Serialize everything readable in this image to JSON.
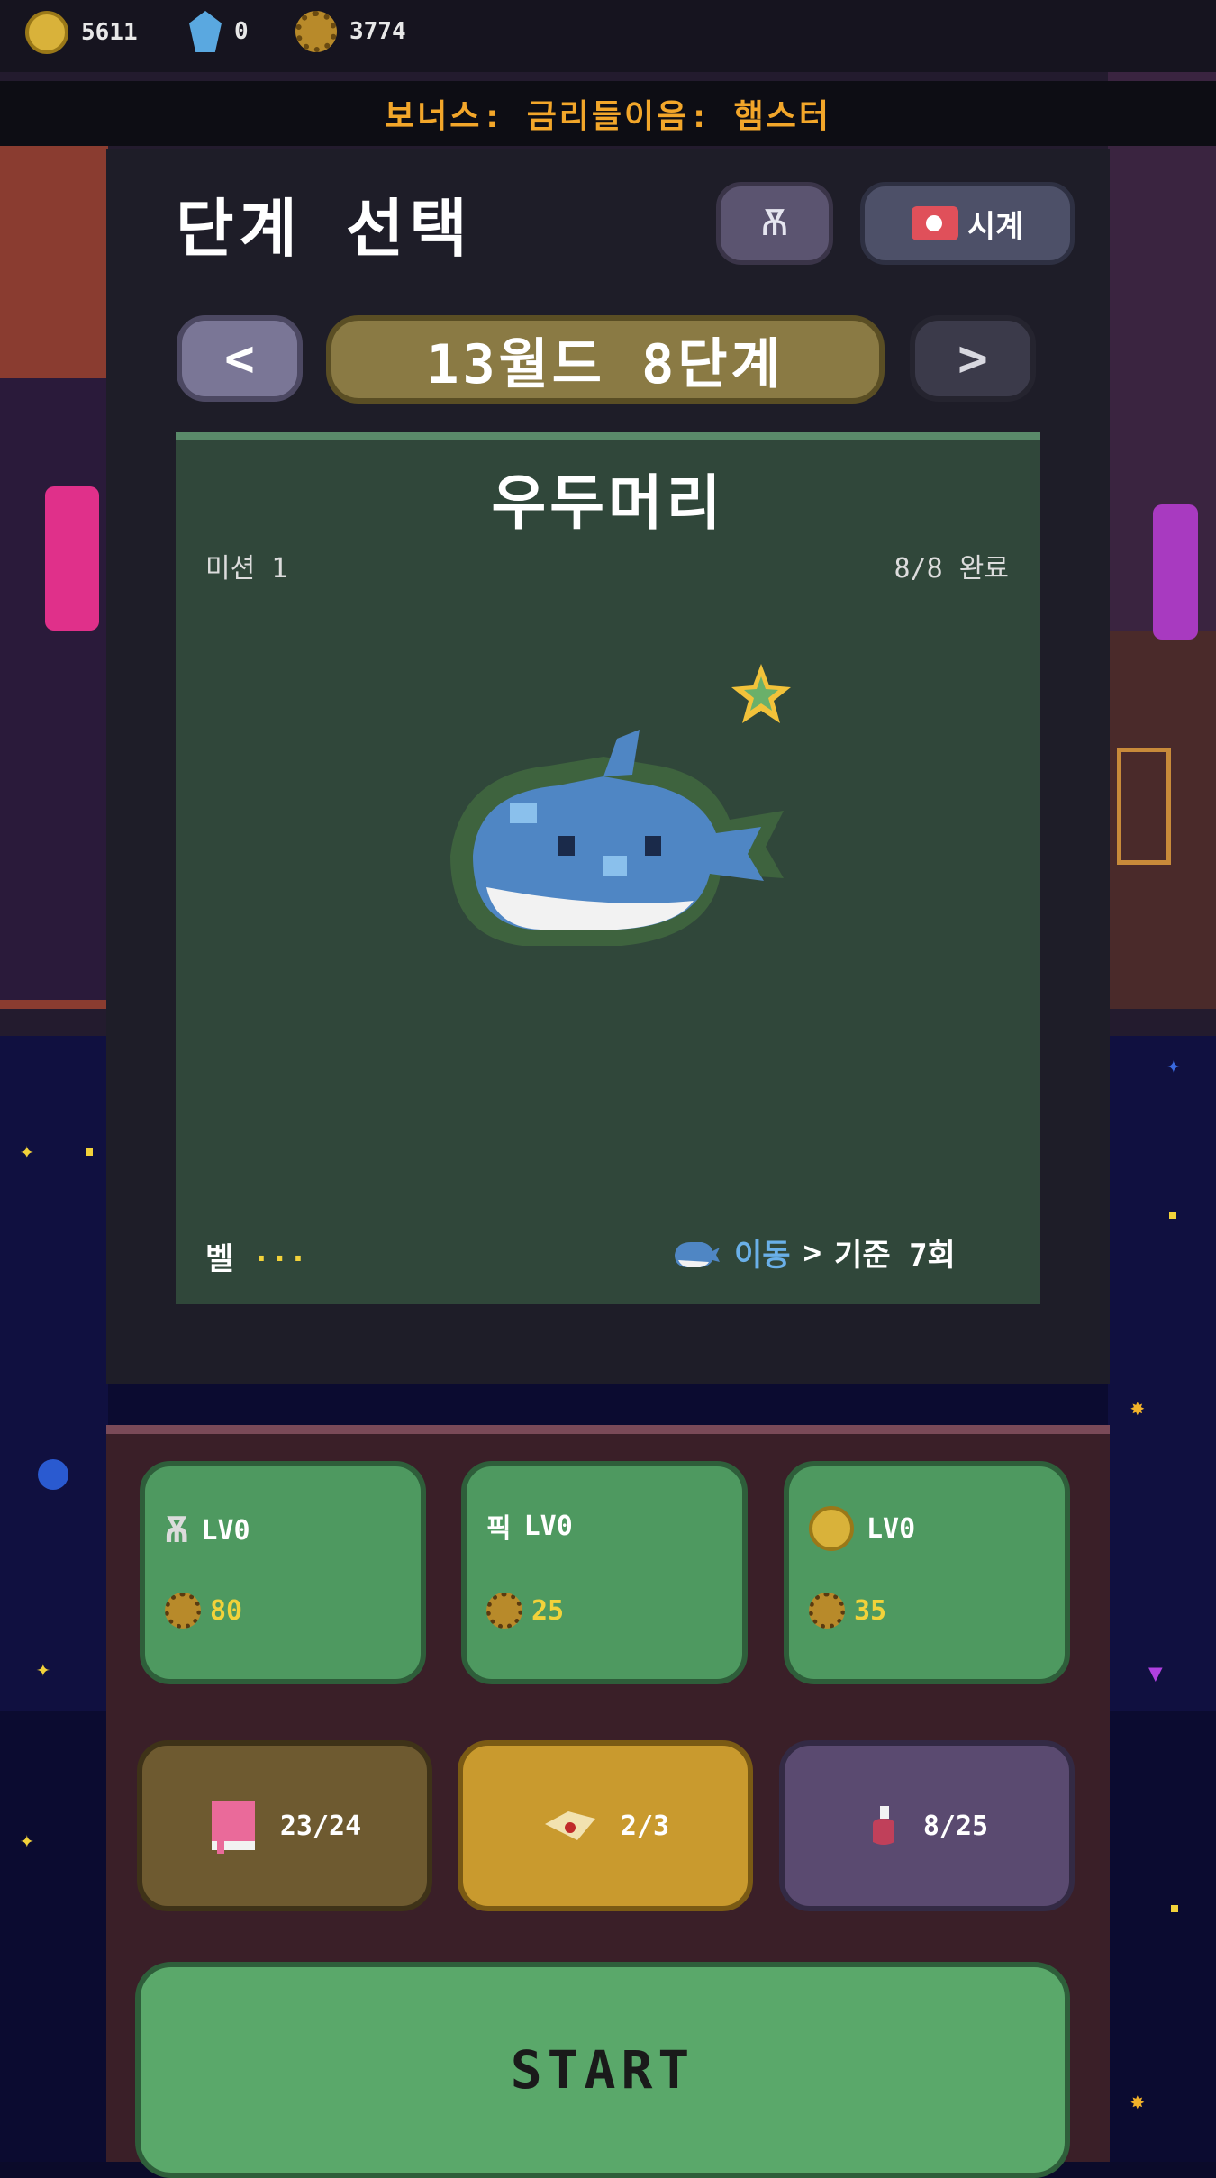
{
  "resources": {
    "coins": "5611",
    "gems": "0",
    "gears": "3774"
  },
  "banner": "보너스: 금리들이음: 햄스터",
  "header": {
    "title": "단계 선택",
    "clock_label": "시계"
  },
  "stage_nav": {
    "prev_label": "<",
    "next_label": ">",
    "stage_label": "13월드 8단계"
  },
  "boss_card": {
    "name": "우두머리",
    "mission": "미션 1",
    "clear_count": "8/8 완료",
    "level_label": "벨",
    "level_dots": "···",
    "move_label": "이동",
    "move_arrow": ">",
    "move_value": "기준 7회"
  },
  "upgrades": [
    {
      "label": "LV0",
      "cost": "80",
      "icon": "spider-icon"
    },
    {
      "label": "LV0",
      "cost": "25",
      "icon": "pick-icon",
      "prefix": "픽"
    },
    {
      "label": "LV0",
      "cost": "35",
      "icon": "coin-icon"
    }
  ],
  "stats": [
    {
      "value": "23/24",
      "icon": "book-icon",
      "color": "#6e5a30"
    },
    {
      "value": "2/3",
      "icon": "scroll-icon",
      "color": "#c99a2e"
    },
    {
      "value": "8/25",
      "icon": "potion-icon",
      "color": "#5a4a70"
    }
  ],
  "start_label": "START",
  "colors": {
    "accent_orange": "#f2a62a",
    "green_button": "#4e9960",
    "card_green": "#30473a"
  }
}
